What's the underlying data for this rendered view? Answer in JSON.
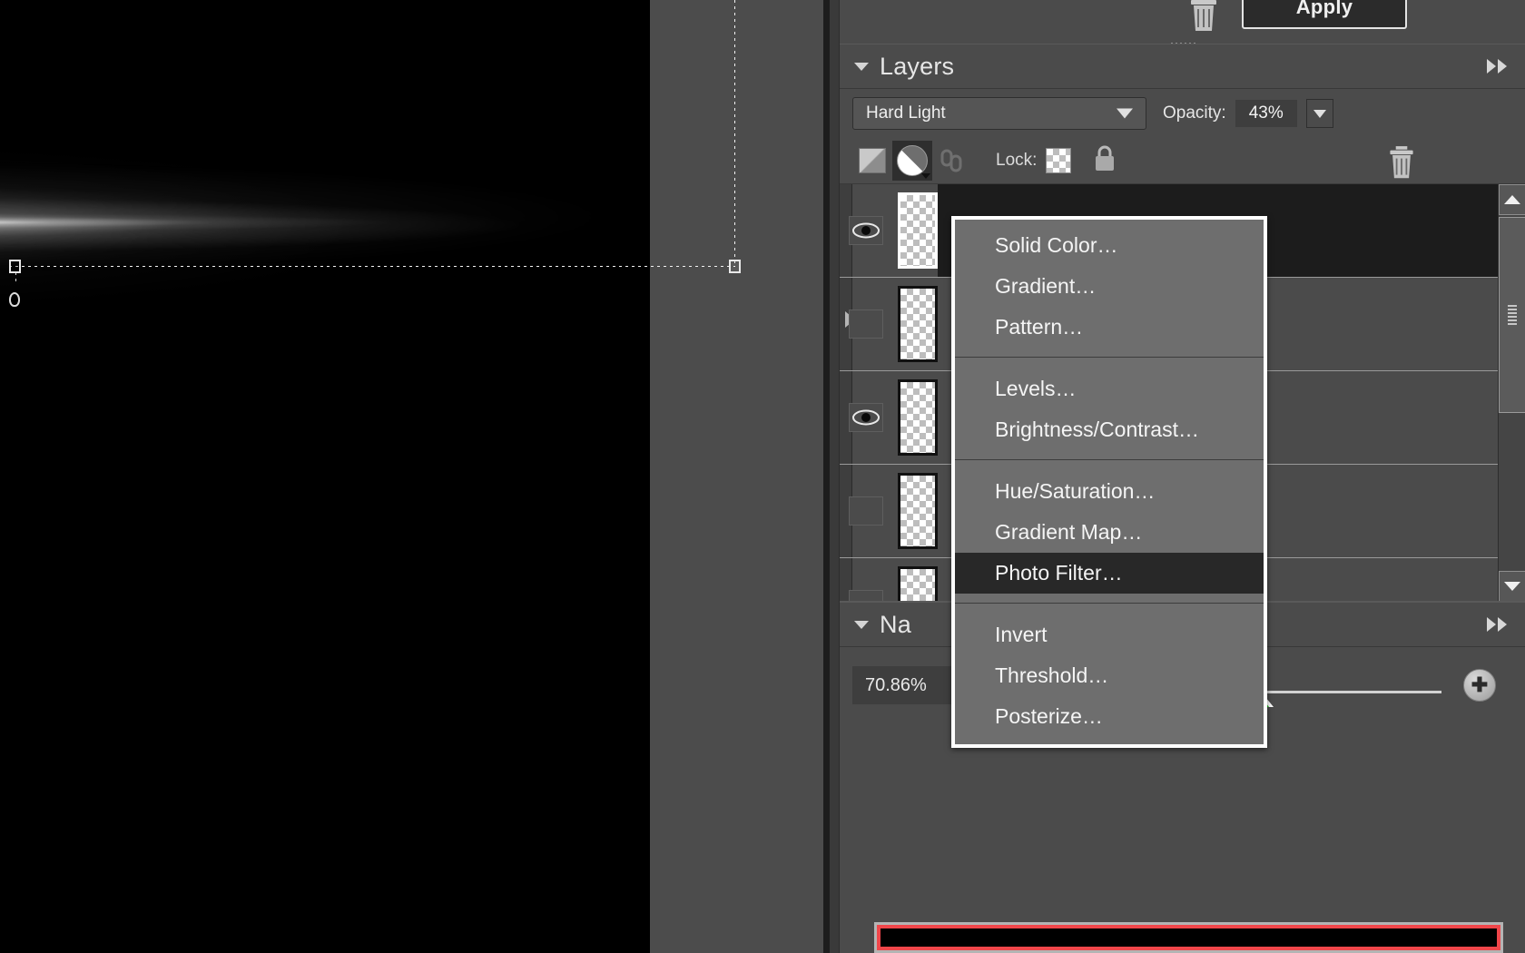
{
  "app": {
    "name": "photo-editor",
    "accent_highlight": "#282828",
    "menu_bg": "#6e6e6e",
    "panel_bg": "#4b4b4b",
    "navigator_view_box_color": "#f0464a"
  },
  "top_strip": {
    "trash_icon": "trash-icon",
    "apply_label": "Apply"
  },
  "layers_panel": {
    "title": "Layers",
    "collapse_icon": "triangle-down-icon",
    "expand_icon": "double-arrow-right-icon",
    "blend_mode": {
      "value": "Hard Light",
      "caret_icon": "chevron-down-icon"
    },
    "opacity": {
      "label": "Opacity:",
      "value": "43%",
      "caret_icon": "chevron-down-icon"
    },
    "tools": {
      "mask_icon": "add-layer-mask-icon",
      "adjustment_icon": "new-adjustment-layer-icon",
      "link_icon": "link-layers-icon",
      "lock_label": "Lock:",
      "lock_transparency_icon": "checkerboard-icon",
      "lock_all_icon": "padlock-icon",
      "delete_icon": "trash-icon"
    },
    "rows": [
      {
        "name": "layer-row-1",
        "visible": true,
        "selected": true,
        "eye_icon": "eye-icon"
      },
      {
        "name": "layer-row-2",
        "visible": false,
        "selected": false,
        "eye_icon": "eye-icon"
      },
      {
        "name": "layer-row-3",
        "visible": true,
        "selected": false,
        "eye_icon": "eye-icon"
      },
      {
        "name": "layer-row-4",
        "visible": false,
        "selected": false,
        "eye_icon": "eye-icon"
      },
      {
        "name": "layer-row-5",
        "visible": false,
        "selected": false,
        "eye_icon": "eye-icon"
      }
    ],
    "scrollbar": {
      "up_icon": "scroll-up-arrow-icon",
      "down_icon": "scroll-down-arrow-icon",
      "grip_icon": "scrollbar-grip-icon"
    }
  },
  "adjustment_menu": {
    "name": "new-adjustment-layer-menu",
    "groups": [
      {
        "items": [
          {
            "label": "Solid Color…",
            "highlighted": false
          },
          {
            "label": "Gradient…",
            "highlighted": false
          },
          {
            "label": "Pattern…",
            "highlighted": false
          }
        ]
      },
      {
        "items": [
          {
            "label": "Levels…",
            "highlighted": false
          },
          {
            "label": "Brightness/Contrast…",
            "highlighted": false
          }
        ]
      },
      {
        "items": [
          {
            "label": "Hue/Saturation…",
            "highlighted": false
          },
          {
            "label": "Gradient Map…",
            "highlighted": false
          },
          {
            "label": "Photo Filter…",
            "highlighted": true
          }
        ]
      },
      {
        "items": [
          {
            "label": "Invert",
            "highlighted": false
          },
          {
            "label": "Threshold…",
            "highlighted": false
          },
          {
            "label": "Posterize…",
            "highlighted": false
          }
        ]
      }
    ]
  },
  "navigator_panel": {
    "title": "Na",
    "collapse_icon": "triangle-down-icon",
    "expand_icon": "double-arrow-right-icon",
    "zoom_value": "70.86%",
    "zoom_out_icon": "zoom-out-icon",
    "zoom_in_icon": "zoom-in-icon",
    "zoom_out_glyph": "–",
    "zoom_in_glyph": "✚"
  },
  "canvas": {
    "selection_handles": [
      "left-middle-handle",
      "right-middle-handle"
    ],
    "rotate_handle": "rotate-handle",
    "marquee": "selection-marquee"
  }
}
